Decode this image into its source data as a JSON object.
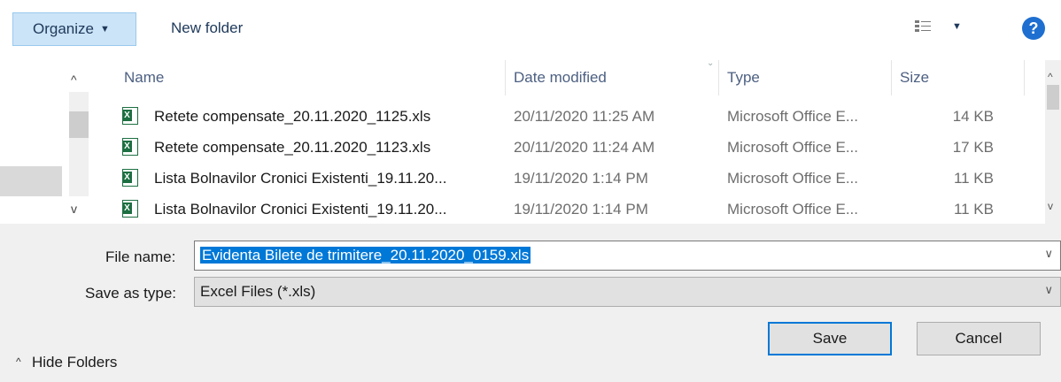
{
  "toolbar": {
    "organize_label": "Organize",
    "new_folder_label": "New folder",
    "help_label": "?"
  },
  "file_list": {
    "columns": [
      "Name",
      "Date modified",
      "Type",
      "Size"
    ],
    "rows": [
      {
        "name": "Retete compensate_20.11.2020_1125.xls",
        "date": "20/11/2020 11:25 AM",
        "type": "Microsoft Office E...",
        "size": "14 KB"
      },
      {
        "name": "Retete compensate_20.11.2020_1123.xls",
        "date": "20/11/2020 11:24 AM",
        "type": "Microsoft Office E...",
        "size": "17 KB"
      },
      {
        "name": "Lista Bolnavilor Cronici Existenti_19.11.20...",
        "date": "19/11/2020 1:14 PM",
        "type": "Microsoft Office E...",
        "size": "11 KB"
      },
      {
        "name": "Lista Bolnavilor Cronici Existenti_19.11.20...",
        "date": "19/11/2020 1:14 PM",
        "type": "Microsoft Office E...",
        "size": "11 KB"
      }
    ]
  },
  "form": {
    "file_name_label": "File name:",
    "file_name_value": "Evidenta Bilete de trimitere_20.11.2020_0159.xls",
    "save_type_label": "Save as type:",
    "save_type_value": "Excel Files (*.xls)"
  },
  "footer": {
    "hide_folders_label": "Hide Folders",
    "save_label": "Save",
    "cancel_label": "Cancel"
  },
  "colors": {
    "accent": "#0078d7",
    "organize_bg": "#cce4f7",
    "excel_green": "#1d6f42"
  },
  "icons": [
    "excel-file-icon",
    "view-options-icon",
    "help-icon",
    "chevron-down-icon",
    "chevron-up-icon"
  ]
}
